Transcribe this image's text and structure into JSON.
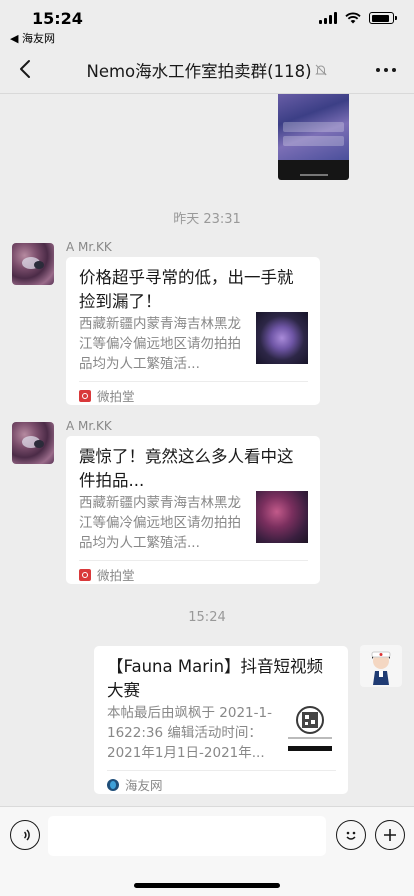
{
  "status_bar": {
    "time": "15:24",
    "back_app": "◀ 海友网",
    "battery_level": 0.85
  },
  "nav": {
    "title": "Nemo海水工作室拍卖群(118)",
    "back_icon": "chevron-left-icon",
    "mute_icon": "bell-off-icon",
    "more_icon": "more-dots-icon"
  },
  "messages": {
    "timestamp_1": "昨天 23:31",
    "timestamp_2": "15:24",
    "card_1": {
      "sender": "A  Mr.KK",
      "title": "价格超乎寻常的低，出一手就捡到漏了！",
      "desc": "西藏新疆内蒙青海吉林黑龙江等偏冷偏远地区请勿拍拍品均为人工繁殖活...",
      "source": "微拍堂"
    },
    "card_2": {
      "sender": "A  Mr.KK",
      "title": "震惊了！竟然这么多人看中这件拍品...",
      "desc": "西藏新疆内蒙青海吉林黑龙江等偏冷偏远地区请勿拍拍品均为人工繁殖活...",
      "source": "微拍堂"
    },
    "card_3": {
      "title": "【Fauna Marin】抖音短视频大赛",
      "desc": "本帖最后由飒枫于 2021-1-1622:36 编辑活动时间：2021年1月1日-2021年...",
      "source": "海友网"
    }
  },
  "input_bar": {
    "voice_icon": "voice-icon",
    "emoji_icon": "emoji-icon",
    "plus_icon": "plus-icon"
  }
}
